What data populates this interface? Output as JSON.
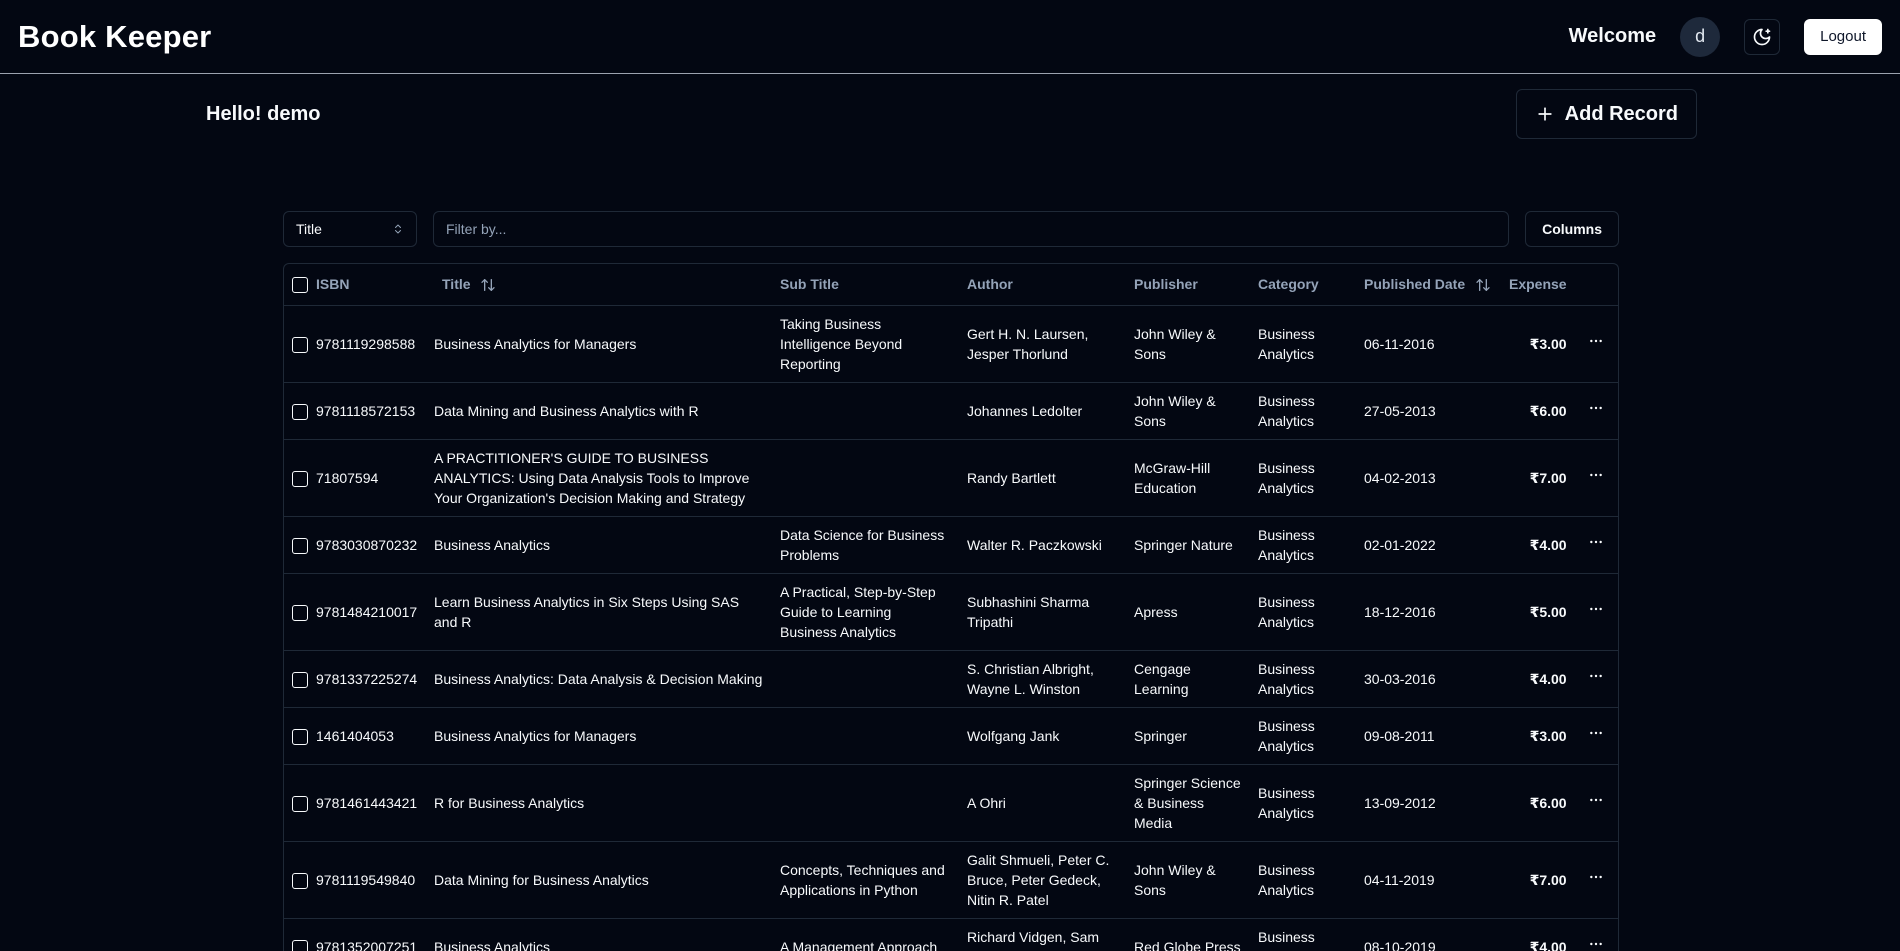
{
  "header": {
    "brand": "Book Keeper",
    "welcome": "Welcome",
    "avatar_initial": "d",
    "logout_label": "Logout"
  },
  "top": {
    "greeting": "Hello! demo",
    "add_label": "Add Record"
  },
  "filters": {
    "field_select": "Title",
    "placeholder": "Filter by...",
    "columns_label": "Columns"
  },
  "table": {
    "headers": {
      "isbn": "ISBN",
      "title": "Title",
      "subtitle": "Sub Title",
      "author": "Author",
      "publisher": "Publisher",
      "category": "Category",
      "published": "Published Date",
      "expense": "Expense"
    },
    "rows": [
      {
        "isbn": "9781119298588",
        "title": "Business Analytics for Managers",
        "subtitle": "Taking Business Intelligence Beyond Reporting",
        "author": "Gert H. N. Laursen, Jesper Thorlund",
        "publisher": "John Wiley & Sons",
        "category": "Business Analytics",
        "date": "06-11-2016",
        "expense": "₹3.00"
      },
      {
        "isbn": "9781118572153",
        "title": "Data Mining and Business Analytics with R",
        "subtitle": "",
        "author": "Johannes Ledolter",
        "publisher": "John Wiley & Sons",
        "category": "Business Analytics",
        "date": "27-05-2013",
        "expense": "₹6.00"
      },
      {
        "isbn": "71807594",
        "title": "A PRACTITIONER'S GUIDE TO BUSINESS ANALYTICS: Using Data Analysis Tools to Improve Your Organization's Decision Making and Strategy",
        "subtitle": "",
        "author": "Randy Bartlett",
        "publisher": "McGraw-Hill Education",
        "category": "Business Analytics",
        "date": "04-02-2013",
        "expense": "₹7.00"
      },
      {
        "isbn": "9783030870232",
        "title": "Business Analytics",
        "subtitle": "Data Science for Business Problems",
        "author": "Walter R. Paczkowski",
        "publisher": "Springer Nature",
        "category": "Business Analytics",
        "date": "02-01-2022",
        "expense": "₹4.00"
      },
      {
        "isbn": "9781484210017",
        "title": "Learn Business Analytics in Six Steps Using SAS and R",
        "subtitle": "A Practical, Step-by-Step Guide to Learning Business Analytics",
        "author": "Subhashini Sharma Tripathi",
        "publisher": "Apress",
        "category": "Business Analytics",
        "date": "18-12-2016",
        "expense": "₹5.00"
      },
      {
        "isbn": "9781337225274",
        "title": "Business Analytics: Data Analysis & Decision Making",
        "subtitle": "",
        "author": "S. Christian Albright, Wayne L. Winston",
        "publisher": "Cengage Learning",
        "category": "Business Analytics",
        "date": "30-03-2016",
        "expense": "₹4.00"
      },
      {
        "isbn": "1461404053",
        "title": "Business Analytics for Managers",
        "subtitle": "",
        "author": "Wolfgang Jank",
        "publisher": "Springer",
        "category": "Business Analytics",
        "date": "09-08-2011",
        "expense": "₹3.00"
      },
      {
        "isbn": "9781461443421",
        "title": "R for Business Analytics",
        "subtitle": "",
        "author": "A Ohri",
        "publisher": "Springer Science & Business Media",
        "category": "Business Analytics",
        "date": "13-09-2012",
        "expense": "₹6.00"
      },
      {
        "isbn": "9781119549840",
        "title": "Data Mining for Business Analytics",
        "subtitle": "Concepts, Techniques and Applications in Python",
        "author": "Galit Shmueli, Peter C. Bruce, Peter Gedeck, Nitin R. Patel",
        "publisher": "John Wiley & Sons",
        "category": "Business Analytics",
        "date": "04-11-2019",
        "expense": "₹7.00"
      },
      {
        "isbn": "9781352007251",
        "title": "Business Analytics",
        "subtitle": "A Management Approach",
        "author": "Richard Vidgen, Sam Kirshner, Felix Tan",
        "publisher": "Red Globe Press",
        "category": "Business Analytics",
        "date": "08-10-2019",
        "expense": "₹4.00"
      }
    ]
  }
}
